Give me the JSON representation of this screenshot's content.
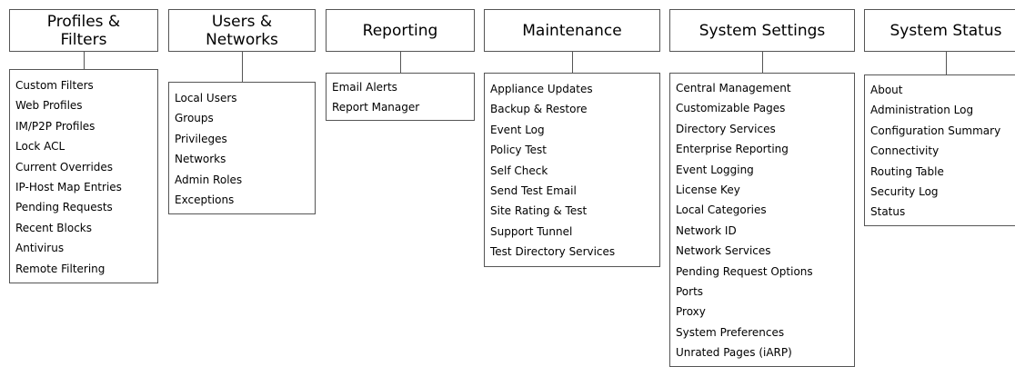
{
  "columns": [
    {
      "id": "profiles",
      "title": "Profiles &\nFilters",
      "items": [
        "Custom Filters",
        "Web Profiles",
        "IM/P2P Profiles",
        "Lock ACL",
        "Current Overrides",
        "IP-Host Map Entries",
        "Pending Requests",
        "Recent Blocks",
        "Antivirus",
        "Remote Filtering"
      ]
    },
    {
      "id": "users",
      "title": "Users &\nNetworks",
      "items": [
        "Local Users",
        "Groups",
        "Privileges",
        "Networks",
        "Admin Roles",
        "Exceptions"
      ]
    },
    {
      "id": "reporting",
      "title": "Reporting",
      "items": [
        "Email Alerts",
        "Report Manager"
      ]
    },
    {
      "id": "maintenance",
      "title": "Maintenance",
      "items": [
        "Appliance Updates",
        "Backup & Restore",
        "Event Log",
        "Policy Test",
        "Self Check",
        "Send Test Email",
        "Site Rating & Test",
        "Support Tunnel",
        "Test Directory Services"
      ]
    },
    {
      "id": "system-settings",
      "title": "System Settings",
      "items": [
        "Central Management",
        "Customizable Pages",
        "Directory Services",
        "Enterprise Reporting",
        "Event Logging",
        "License Key",
        "Local Categories",
        "Network ID",
        "Network Services",
        "Pending Request Options",
        "Ports",
        "Proxy",
        "System Preferences",
        "Unrated Pages (iARP)"
      ]
    },
    {
      "id": "system-status",
      "title": "System Status",
      "items": [
        "About",
        "Administration Log",
        "Configuration Summary",
        "Connectivity",
        "Routing Table",
        "Security Log",
        "Status"
      ]
    }
  ]
}
